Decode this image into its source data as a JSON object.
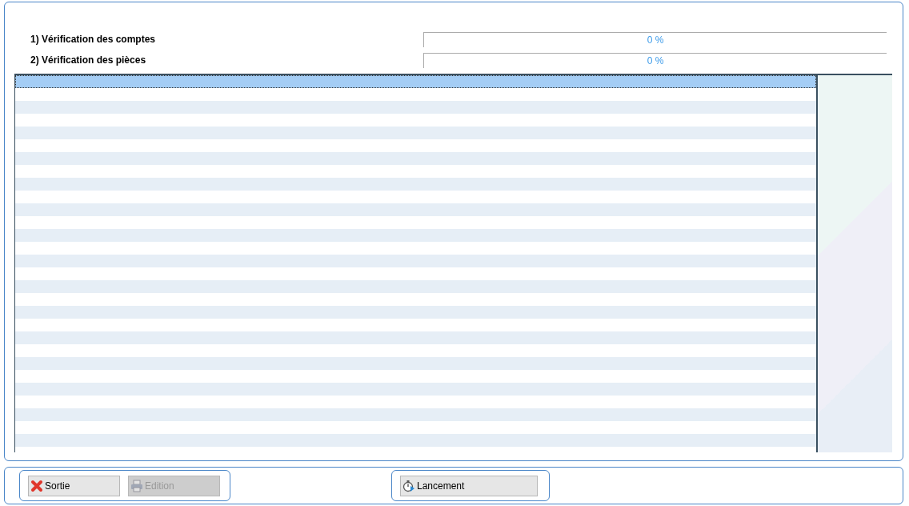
{
  "progress": [
    {
      "label": "1) Vérification des comptes",
      "level": 0,
      "reading": "0 %"
    },
    {
      "label": "2) Vérification des pièces",
      "level": 0,
      "reading": "0 %"
    }
  ],
  "table": {
    "rows": [
      {
        "selected": true
      },
      {
        "selected": false
      },
      {
        "selected": false
      },
      {
        "selected": false
      },
      {
        "selected": false
      },
      {
        "selected": false
      },
      {
        "selected": false
      },
      {
        "selected": false
      },
      {
        "selected": false
      },
      {
        "selected": false
      },
      {
        "selected": false
      },
      {
        "selected": false
      },
      {
        "selected": false
      },
      {
        "selected": false
      },
      {
        "selected": false
      },
      {
        "selected": false
      },
      {
        "selected": false
      },
      {
        "selected": false
      },
      {
        "selected": false
      },
      {
        "selected": false
      },
      {
        "selected": false
      },
      {
        "selected": false
      },
      {
        "selected": false
      },
      {
        "selected": false
      },
      {
        "selected": false
      },
      {
        "selected": false
      },
      {
        "selected": false
      },
      {
        "selected": false
      },
      {
        "selected": false
      }
    ]
  },
  "buttons": [
    {
      "kind": "exit",
      "label": "Sortie",
      "disabled": false
    },
    {
      "kind": "print",
      "label": "Edition",
      "disabled": true
    },
    {
      "kind": "launch",
      "label": "Lancement",
      "disabled": false
    }
  ]
}
